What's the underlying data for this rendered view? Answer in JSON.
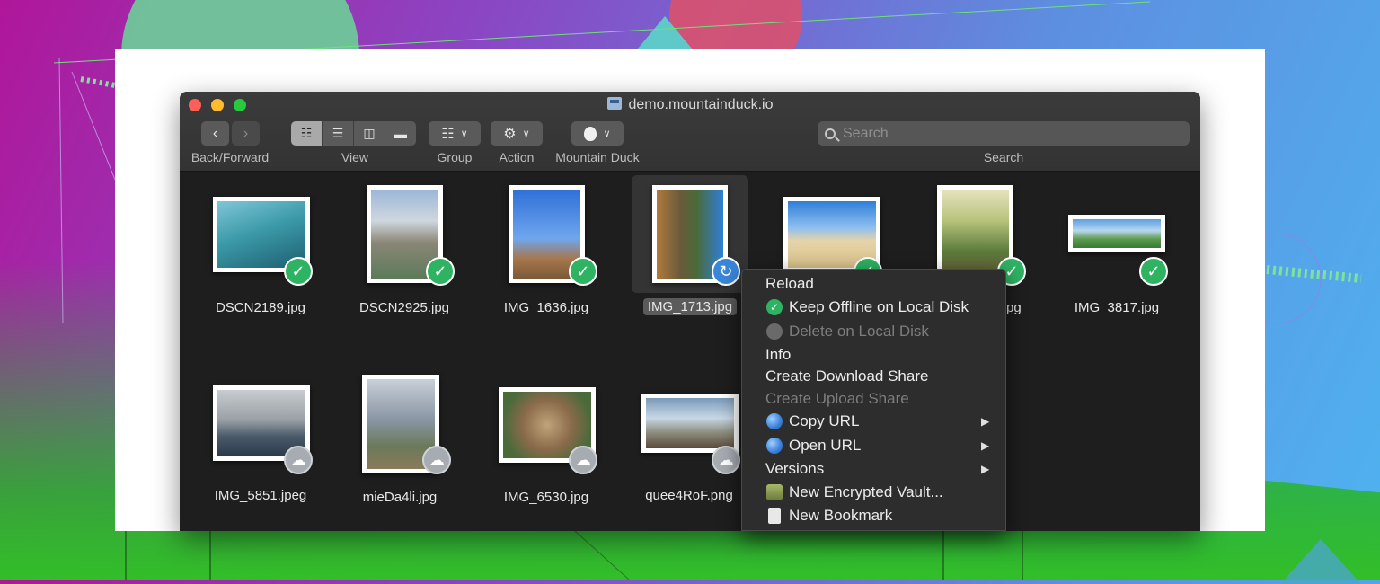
{
  "window": {
    "title": "demo.mountainduck.io"
  },
  "toolbar": {
    "back_label": "Back/Forward",
    "view_label": "View",
    "group_label": "Group",
    "action_label": "Action",
    "mountain_label": "Mountain Duck",
    "search_label": "Search",
    "search_placeholder": "Search"
  },
  "files": [
    {
      "name": "DSCN2189.jpg",
      "status": "offline"
    },
    {
      "name": "DSCN2925.jpg",
      "status": "offline"
    },
    {
      "name": "IMG_1636.jpg",
      "status": "offline"
    },
    {
      "name": "IMG_1713.jpg",
      "status": "syncing",
      "selected": true
    },
    {
      "name": "IMG_3817.jpg",
      "status": "offline"
    },
    {
      "name": "IMG_5851.jpeg",
      "status": "cloud"
    },
    {
      "name": "mieDa4li.jpg",
      "status": "cloud"
    },
    {
      "name": "IMG_6530.jpg",
      "status": "cloud"
    },
    {
      "name": "quee4RoF.png",
      "status": "cloud"
    },
    {
      "name": "pg",
      "status": "offline"
    }
  ],
  "context_menu": {
    "reload": "Reload",
    "keep_offline": "Keep Offline on Local Disk",
    "delete_local": "Delete on Local Disk",
    "info": "Info",
    "create_download_share": "Create Download Share",
    "create_upload_share": "Create Upload Share",
    "copy_url": "Copy URL",
    "open_url": "Open URL",
    "versions": "Versions",
    "new_vault": "New Encrypted Vault...",
    "new_bookmark": "New Bookmark"
  },
  "colors": {
    "window_bg": "#1e1e1e",
    "badge_ok": "#2eb363",
    "badge_sync": "#3a86d9",
    "badge_cloud": "#a7acb3"
  }
}
